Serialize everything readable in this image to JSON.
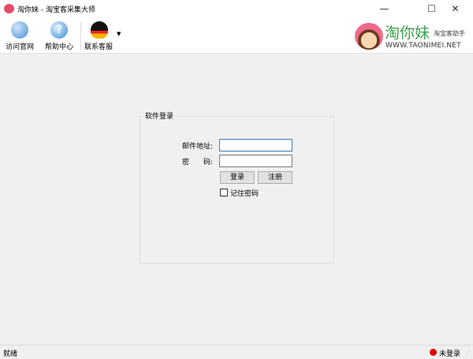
{
  "window": {
    "title": "淘你妹 - 淘宝客采集大师",
    "minimize": "—",
    "maximize": "☐",
    "close": "✕"
  },
  "toolbar": {
    "items": [
      {
        "label": "访问官网",
        "icon": "globe-icon"
      },
      {
        "label": "帮助中心",
        "icon": "help-icon"
      },
      {
        "label": "联系客服",
        "icon": "qq-penguin-icon"
      }
    ]
  },
  "brand": {
    "name": "淘你妹",
    "tagline": "淘宝客助手",
    "url": "WWW.TAONIMEI.NET"
  },
  "login": {
    "group_title": "软件登录",
    "email_label": "邮件地址:",
    "email_value": "",
    "password_label": "密　　码:",
    "password_value": "",
    "login_button": "登录",
    "register_button": "注册",
    "remember_label": "记住密码",
    "remember_checked": false
  },
  "status": {
    "left": "就绪",
    "login_state": "未登录",
    "indicator_color": "#e00000"
  }
}
